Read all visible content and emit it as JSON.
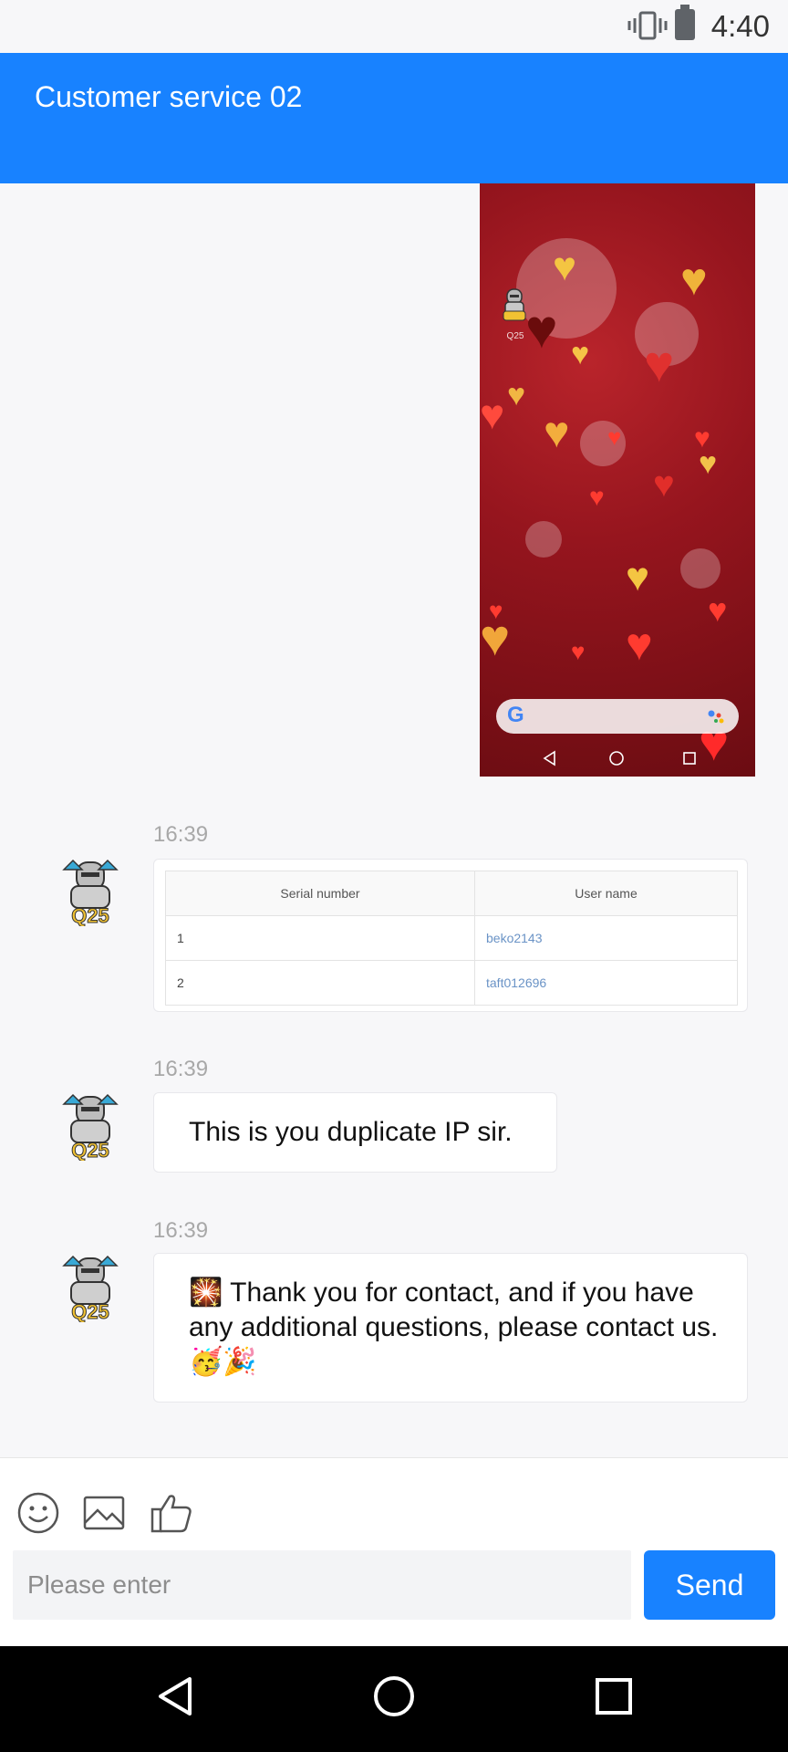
{
  "status_bar": {
    "time": "4:40",
    "icons": [
      "vibrate-icon",
      "battery-icon"
    ]
  },
  "header": {
    "title": "Customer service 02"
  },
  "image_message": {
    "app_label": "Q25",
    "google_logo": "G",
    "nav_icons": [
      "back-icon",
      "home-icon",
      "recents-icon"
    ]
  },
  "messages": [
    {
      "time": "16:39",
      "type": "table",
      "table": {
        "headers": [
          "Serial number",
          "User name"
        ],
        "rows": [
          [
            "1",
            "beko2143"
          ],
          [
            "2",
            "taft012696"
          ]
        ]
      }
    },
    {
      "time": "16:39",
      "type": "text",
      "text": "This is you duplicate IP sir."
    },
    {
      "time": "16:39",
      "type": "text",
      "text": "🎇 Thank you for contact, and if you have any additional questions, please contact us. 🥳🎉"
    }
  ],
  "composer": {
    "tools": [
      "emoji-icon",
      "image-icon",
      "like-icon"
    ],
    "placeholder": "Please enter",
    "send_label": "Send"
  },
  "nav_bar": {
    "buttons": [
      "back-icon",
      "home-icon",
      "recents-icon"
    ]
  },
  "colors": {
    "accent": "#1882ff",
    "background": "#f7f7f9",
    "nav": "#000000"
  }
}
